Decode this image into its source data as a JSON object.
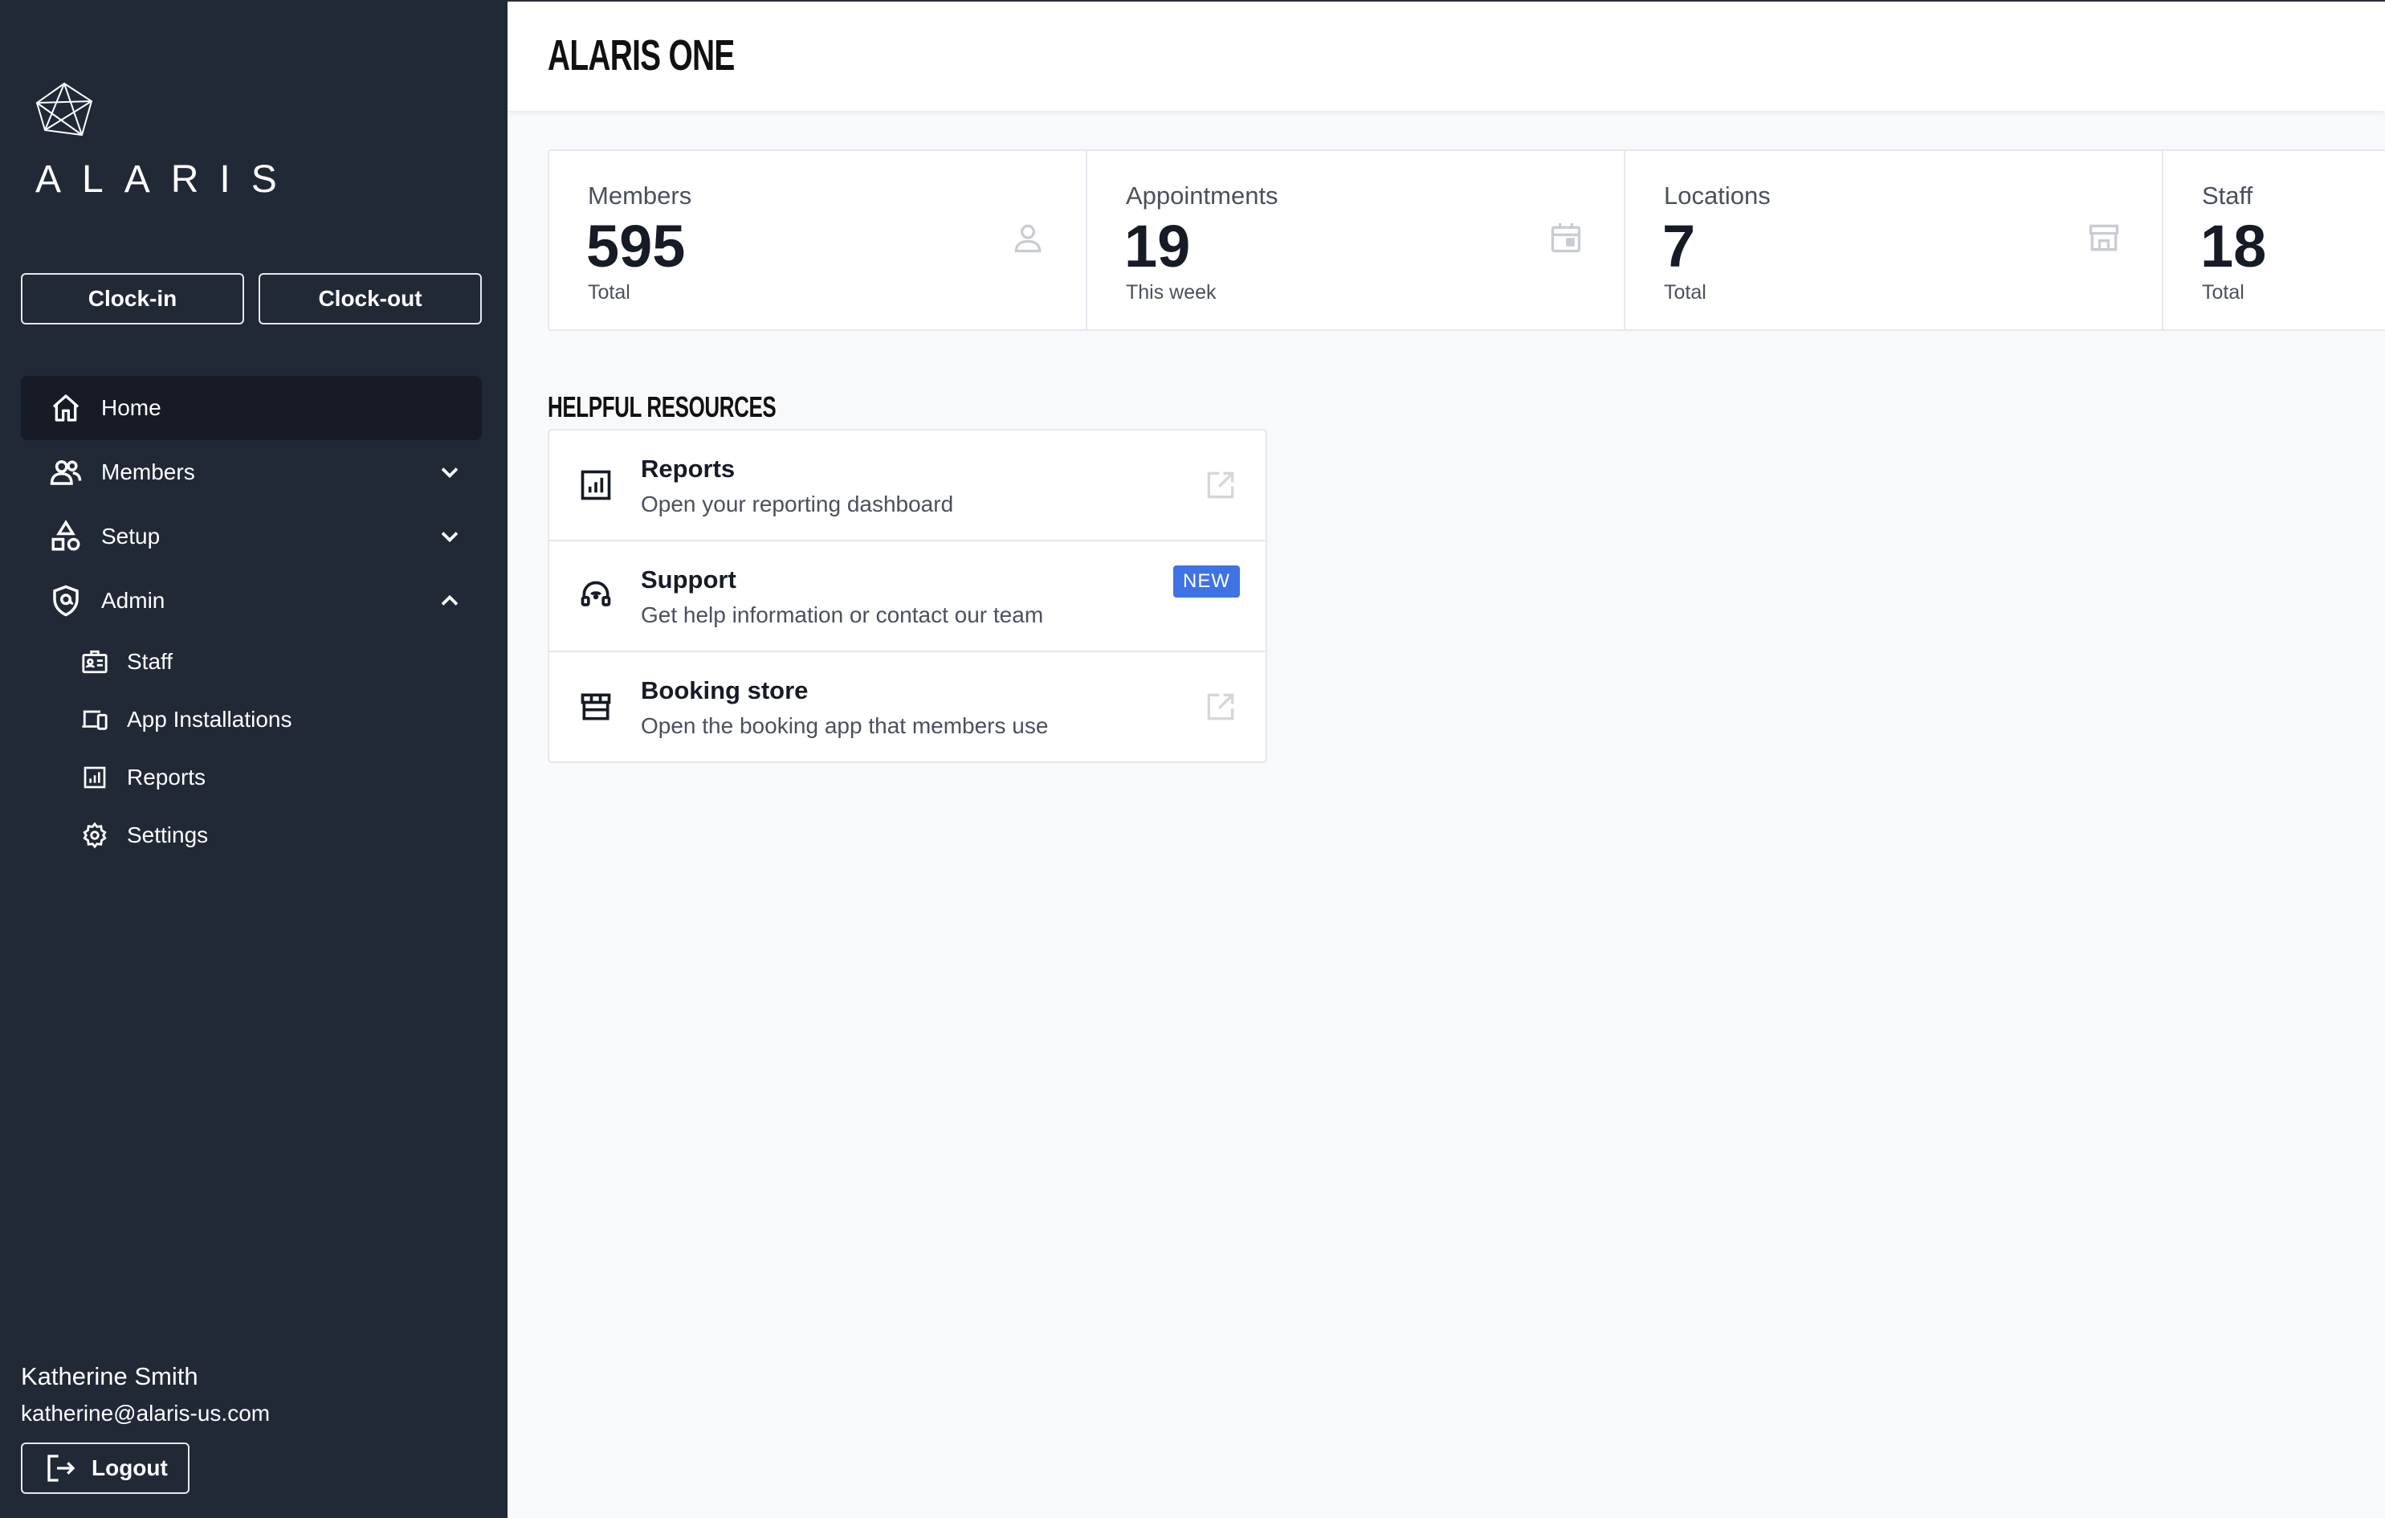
{
  "brand": {
    "name": "ALARIS"
  },
  "clock": {
    "in_label": "Clock-in",
    "out_label": "Clock-out"
  },
  "nav": {
    "items": [
      {
        "label": "Home",
        "icon": "home-icon",
        "active": true
      },
      {
        "label": "Members",
        "icon": "users-icon",
        "expanded": false
      },
      {
        "label": "Setup",
        "icon": "shapes-icon",
        "expanded": false
      },
      {
        "label": "Admin",
        "icon": "shield-icon",
        "expanded": true
      }
    ],
    "admin_sub": [
      {
        "label": "Staff",
        "icon": "id-badge-icon"
      },
      {
        "label": "App Installations",
        "icon": "devices-icon"
      },
      {
        "label": "Reports",
        "icon": "report-icon"
      },
      {
        "label": "Settings",
        "icon": "gear-icon"
      }
    ]
  },
  "user": {
    "name": "Katherine Smith",
    "email": "katherine@alaris-us.com",
    "logout_label": "Logout"
  },
  "header": {
    "title": "ALARIS ONE"
  },
  "stats": [
    {
      "label": "Members",
      "value": "595",
      "sub": "Total",
      "icon": "user-icon"
    },
    {
      "label": "Appointments",
      "value": "19",
      "sub": "This week",
      "icon": "calendar-icon"
    },
    {
      "label": "Locations",
      "value": "7",
      "sub": "Total",
      "icon": "store-icon"
    },
    {
      "label": "Staff",
      "value": "18",
      "sub": "Total",
      "icon": "staff-icon"
    }
  ],
  "resources": {
    "title": "HELPFUL RESOURCES",
    "items": [
      {
        "title": "Reports",
        "desc": "Open your reporting dashboard",
        "icon": "report-icon",
        "trailing": "external-link-icon"
      },
      {
        "title": "Support",
        "desc": "Get help information or contact our team",
        "icon": "headset-icon",
        "badge": "NEW"
      },
      {
        "title": "Booking store",
        "desc": "Open the booking app that members use",
        "icon": "store-icon",
        "trailing": "external-link-icon"
      }
    ]
  },
  "colors": {
    "sidebar": "#212836",
    "active": "#161b26",
    "accent": "#3f73e3"
  }
}
